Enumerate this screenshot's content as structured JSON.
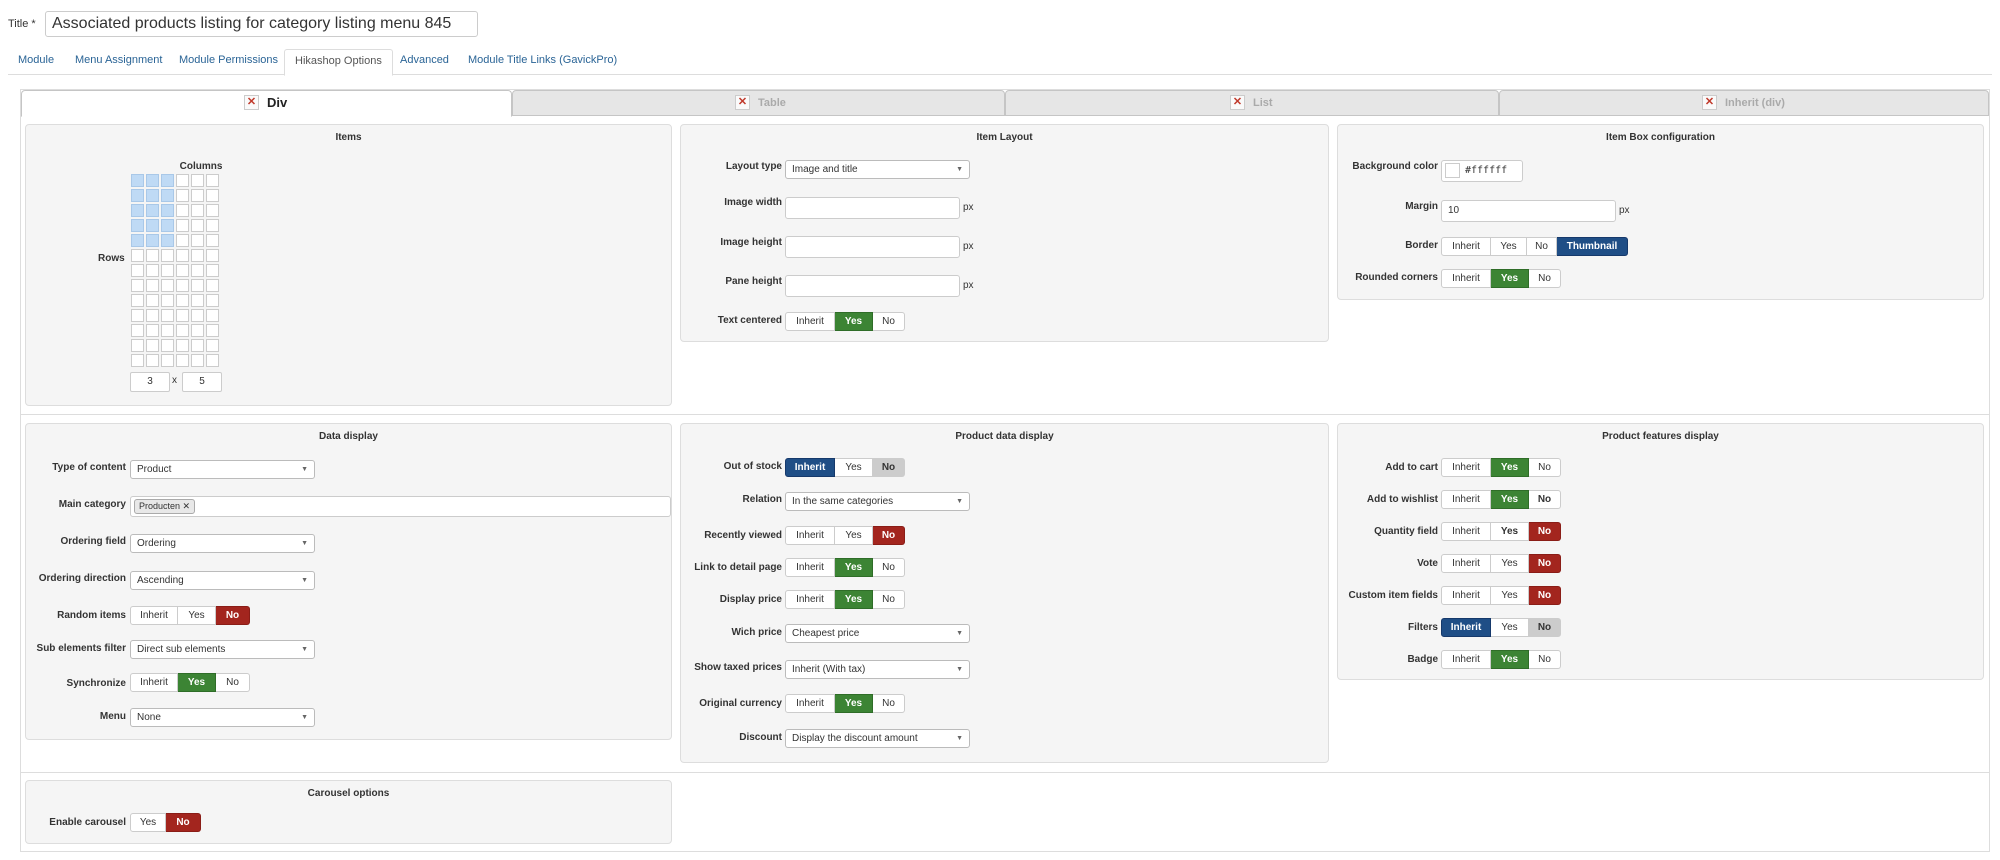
{
  "title": {
    "label": "Title *",
    "value": "Associated products listing for category listing menu 845"
  },
  "module_tabs": [
    "Module",
    "Menu Assignment",
    "Module Permissions",
    "Hikashop Options",
    "Advanced",
    "Module Title Links (GavickPro)"
  ],
  "layout_tabs": [
    "Div",
    "Table",
    "List",
    "Inherit (div)"
  ],
  "items": {
    "title": "Items",
    "columns_label": "Columns",
    "rows_label": "Rows",
    "columns_value": "3",
    "times": "x",
    "rows_value": "5"
  },
  "item_layout": {
    "title": "Item Layout",
    "layout_type_label": "Layout type",
    "layout_type_value": "Image and title",
    "image_width_label": "Image width",
    "image_height_label": "Image height",
    "pane_height_label": "Pane height",
    "unit": "px",
    "text_centered_label": "Text centered"
  },
  "item_box": {
    "title": "Item Box configuration",
    "bg_color_label": "Background color",
    "bg_color_value": "#ffffff",
    "margin_label": "Margin",
    "margin_value": "10",
    "unit": "px",
    "border_label": "Border",
    "rounded_label": "Rounded corners"
  },
  "options": {
    "inherit": "Inherit",
    "yes": "Yes",
    "no": "No",
    "thumbnail": "Thumbnail"
  },
  "data_display": {
    "title": "Data display",
    "type_label": "Type of content",
    "type_value": "Product",
    "main_category_label": "Main category",
    "main_category_tag": "Producten",
    "ordering_field_label": "Ordering field",
    "ordering_field_value": "Ordering",
    "ordering_direction_label": "Ordering direction",
    "ordering_direction_value": "Ascending",
    "random_label": "Random items",
    "sub_filter_label": "Sub elements filter",
    "sub_filter_value": "Direct sub elements",
    "synchronize_label": "Synchronize",
    "menu_label": "Menu",
    "menu_value": "None"
  },
  "product_data": {
    "title": "Product data display",
    "out_of_stock_label": "Out of stock",
    "relation_label": "Relation",
    "relation_value": "In the same categories",
    "recently_viewed_label": "Recently viewed",
    "link_detail_label": "Link to detail page",
    "display_price_label": "Display price",
    "wich_price_label": "Wich price",
    "wich_price_value": "Cheapest price",
    "taxed_prices_label": "Show taxed prices",
    "taxed_prices_value": "Inherit (With tax)",
    "original_currency_label": "Original currency",
    "discount_label": "Discount",
    "discount_value": "Display the discount amount"
  },
  "product_features": {
    "title": "Product features display",
    "add_to_cart_label": "Add to cart",
    "add_to_wishlist_label": "Add to wishlist",
    "quantity_field_label": "Quantity field",
    "vote_label": "Vote",
    "custom_fields_label": "Custom item fields",
    "filters_label": "Filters",
    "badge_label": "Badge"
  },
  "carousel": {
    "title": "Carousel options",
    "enable_label": "Enable carousel"
  },
  "colors": {
    "green": "#3c8434",
    "red": "#a3251e",
    "blue": "#1f4e86",
    "link": "#2a6496"
  }
}
